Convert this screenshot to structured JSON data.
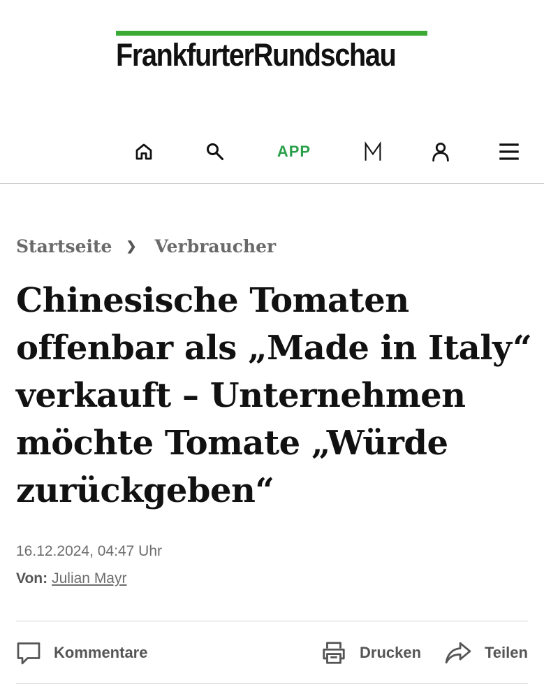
{
  "brand": {
    "name": "FrankfurterRundschau",
    "accent_color": "#3aaa35"
  },
  "nav": {
    "home_icon": "home-icon",
    "search_icon": "search-icon",
    "app_label": "APP",
    "app_color": "#2aa04a",
    "m_label": "M",
    "user_icon": "user-icon",
    "menu_icon": "hamburger-menu-icon"
  },
  "breadcrumb": {
    "items": [
      "Startseite",
      "Verbraucher"
    ],
    "separator": "❯"
  },
  "article": {
    "headline": "Chinesische Tomaten offenbar als „Made in Italy“ verkauft – Unternehmen möchte Tomate „Würde zurückgeben“",
    "date": "16.12.2024, 04:47 Uhr",
    "author_label": "Von:",
    "author_name": "Julian Mayr"
  },
  "actions": {
    "comments_label": "Kommentare",
    "print_label": "Drucken",
    "share_label": "Teilen"
  }
}
